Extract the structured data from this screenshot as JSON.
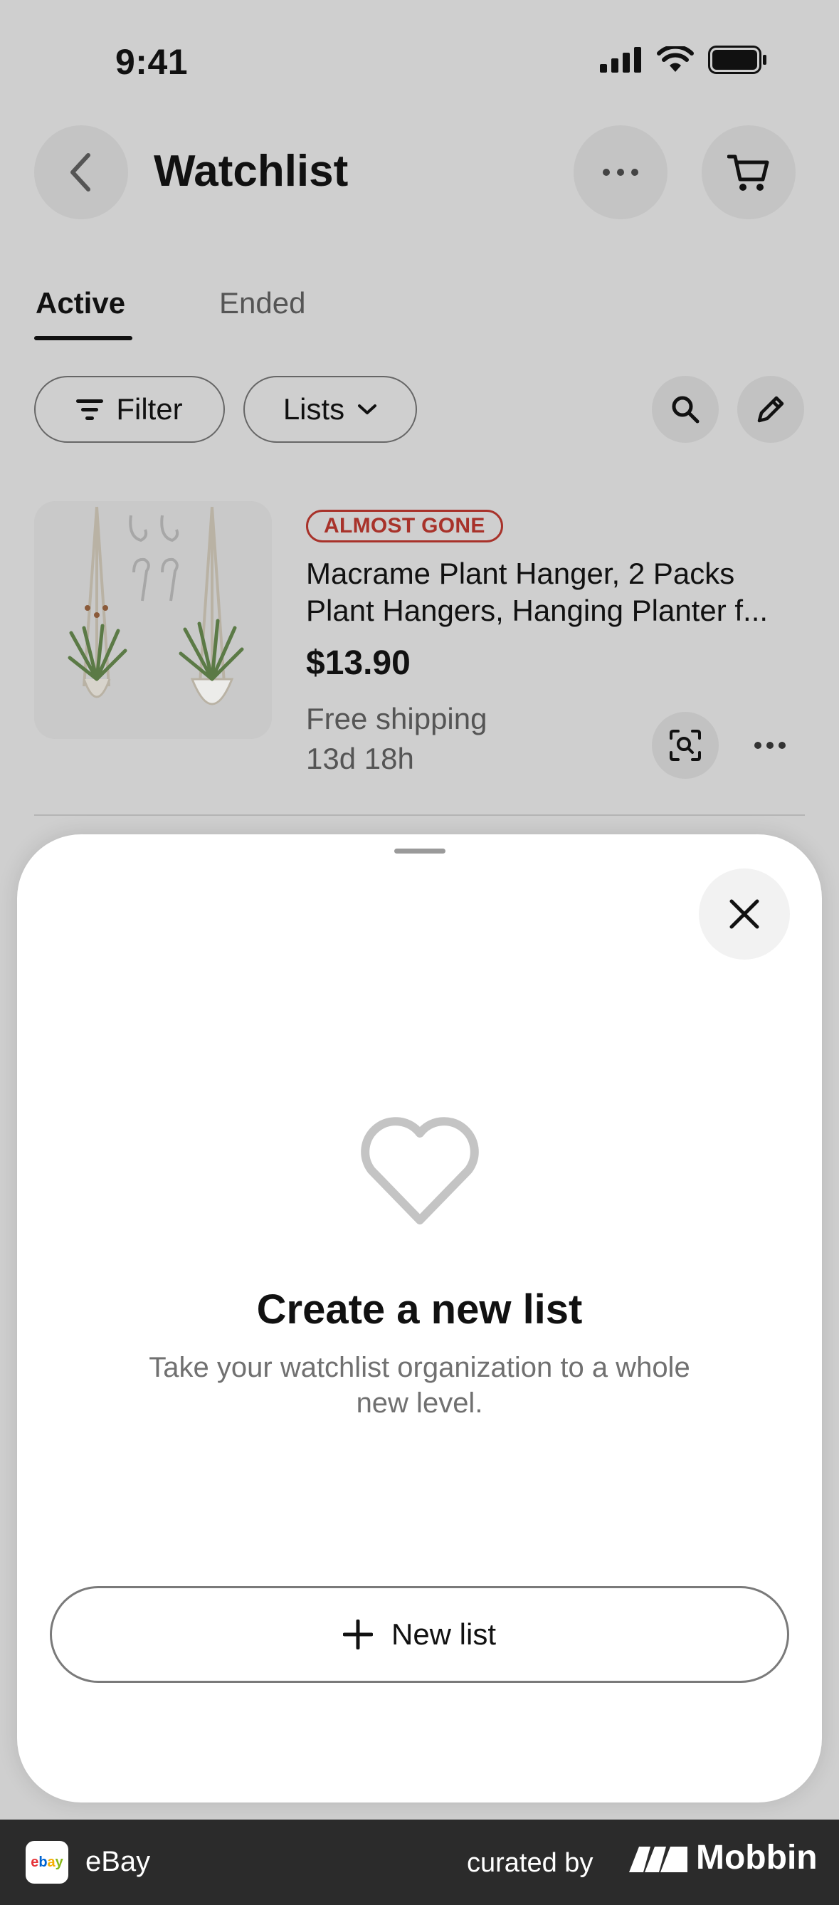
{
  "status_bar": {
    "time": "9:41"
  },
  "header": {
    "title": "Watchlist"
  },
  "tabs": [
    {
      "label": "Active",
      "active": true
    },
    {
      "label": "Ended",
      "active": false
    }
  ],
  "filters": {
    "filter_label": "Filter",
    "lists_label": "Lists"
  },
  "item": {
    "badge": "ALMOST GONE",
    "title_line1": "Macrame Plant Hanger, 2 Packs",
    "title_line2": "Plant Hangers, Hanging Planter f...",
    "price": "$13.90",
    "shipping": "Free shipping",
    "time_left": "13d 18h"
  },
  "sheet": {
    "title": "Create a new list",
    "subtitle": "Take your watchlist organization to a whole new level.",
    "button_label": "New list"
  },
  "footer": {
    "logo_text": "ebay",
    "app_name": "eBay",
    "curated_by": "curated by",
    "brand": "Mobbin"
  },
  "colors": {
    "badge": "#a8322a",
    "backdrop": "#cfcfcf",
    "footer_bg": "#2b2b2b"
  }
}
